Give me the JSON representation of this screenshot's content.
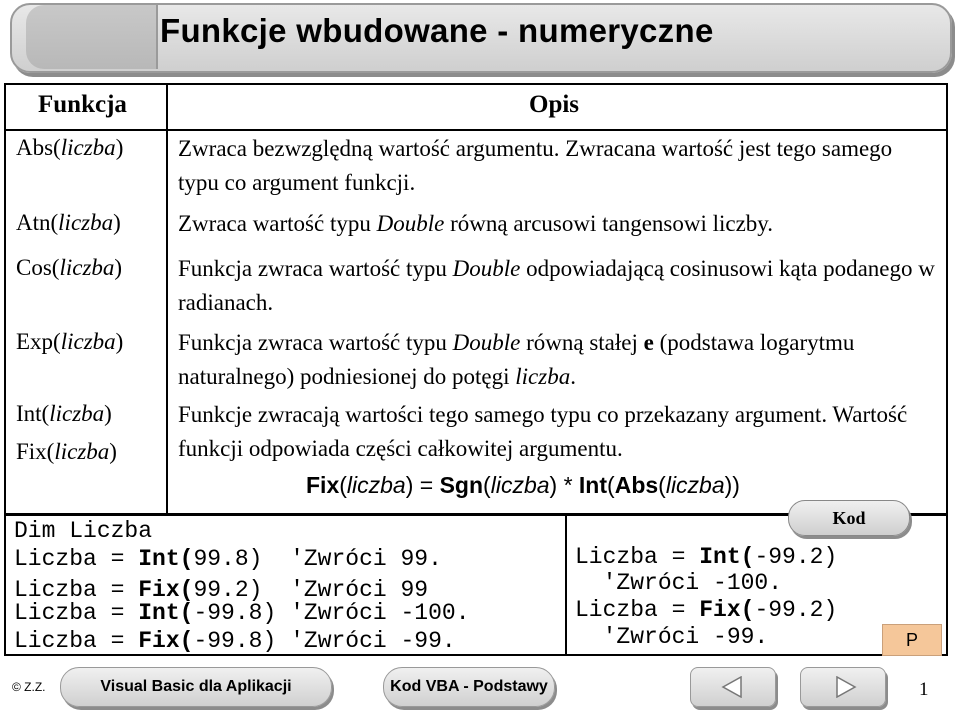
{
  "title": "Funkcje wbudowane - numeryczne",
  "table": {
    "header_function": "Funkcja",
    "header_description": "Opis",
    "rows": [
      {
        "fn": "Abs(",
        "arg": "liczba",
        "close": ")",
        "d1": "Zwraca bezwzględną wartość argumentu. Zwracana wartość jest tego samego typu co argument funkcji."
      },
      {
        "fn": "Atn(",
        "arg": "liczba",
        "close": ")",
        "d1": "Zwraca wartość typu ",
        "d1i": "Double",
        "d2": " równą arcusowi tangensowi liczby."
      },
      {
        "fn": "Cos(",
        "arg": "liczba",
        "close": ")",
        "d1": "Funkcja zwraca wartość typu ",
        "d1i": "Double",
        "d2": " odpowiadającą cosinusowi kąta podanego w radianach."
      },
      {
        "fn": "Exp(",
        "arg": "liczba",
        "close": ")",
        "d1": "Funkcja zwraca wartość typu ",
        "d1i": "Double",
        "d2": " równą stałej ",
        "d2b": "e",
        "d3": " (podstawa logarytmu naturalnego) podniesionej do potęgi ",
        "d3i": "liczba",
        "d4": "."
      },
      {
        "fn": "Int(",
        "arg": "liczba",
        "close": ")",
        "d1": "Funkcje zwracają wartości tego samego typu co przekazany argument. Wartość funkcji odpowiada części całkowitej argumentu."
      },
      {
        "fn": "Fix(",
        "arg": "liczba",
        "close": ")"
      }
    ],
    "formula": {
      "p1": "Fix",
      "p2": "(",
      "p3": "liczba",
      "p4": ") = ",
      "p5": "Sgn",
      "p6": "(",
      "p7": "liczba",
      "p8": ") * ",
      "p9": "Int",
      "p10": "(",
      "p11": "Abs",
      "p12": "(",
      "p13": "liczba",
      "p14": "))"
    }
  },
  "code_left": {
    "l0": "Dim Liczba",
    "lines": [
      {
        "pre": "Liczba = ",
        "fn": "Int(",
        "arg": "99.8)",
        "cm": "  'Zwróci 99."
      },
      {
        "pre": "Liczba = ",
        "fn": "Fix(",
        "arg": "99.2)",
        "cm": "  'Zwróci 99"
      },
      {
        "pre": "Liczba = ",
        "fn": "Int(",
        "arg": "-99.8)",
        "cm": " 'Zwróci -100."
      },
      {
        "pre": "Liczba = ",
        "fn": "Fix(",
        "arg": "-99.8)",
        "cm": " 'Zwróci -99."
      }
    ]
  },
  "code_right": {
    "lines": [
      {
        "pre": "Liczba = ",
        "fn": "Int(",
        "arg": "-99.2)"
      },
      {
        "cm": "  'Zwróci -100."
      },
      {
        "pre": "Liczba = ",
        "fn": "Fix(",
        "arg": "-99.2)"
      },
      {
        "cm": "  'Zwróci -99."
      }
    ]
  },
  "kod_label": "Kod",
  "p_label": "P",
  "footer": {
    "author": "© Z.Z.",
    "course": "Visual Basic dla Aplikacji",
    "section": "Kod VBA - Podstawy",
    "page": "1"
  },
  "icons": [
    "back-arrow-icon",
    "forward-arrow-icon"
  ]
}
